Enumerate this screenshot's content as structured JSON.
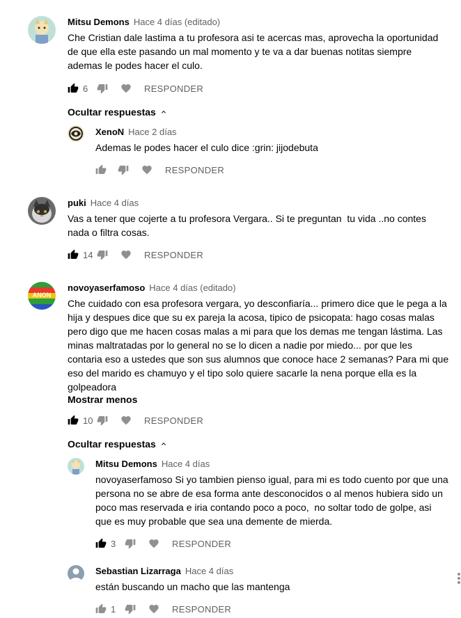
{
  "labels": {
    "reply": "RESPONDER",
    "hide_replies": "Ocultar respuestas",
    "show_less": "Mostrar menos"
  },
  "comments": [
    {
      "author": "Mitsu Demons",
      "time": "Hace 4 días (editado)",
      "text": "Che Cristian dale lastima a tu profesora asi te acercas mas, aprovecha la oportunidad\nde que ella este pasando un mal momento y te va a dar buenas notitas siempre\nademas le podes hacer el culo.",
      "likes": "6"
    },
    {
      "author": "XenoN",
      "time": "Hace 2 días",
      "text": "Ademas le podes hacer el culo dice :grin: jijodebuta",
      "likes": ""
    },
    {
      "author": "puki",
      "time": "Hace 4 días",
      "text": "Vas a tener que cojerte a tu profesora Vergara.. Si te preguntan  tu vida ..no contes\nnada o filtra cosas.",
      "likes": "14"
    },
    {
      "author": "novoyaserfamoso",
      "time": "Hace 4 días (editado)",
      "text": "Che cuidado con esa profesora vergara, yo desconfiaría... primero dice que le pega a la\nhija y despues dice que su ex pareja la acosa, tipico de psicopata: hago cosas malas\npero digo que me hacen cosas malas a mi para que los demas me tengan lástima. Las\nminas maltratadas por lo general no se lo dicen a nadie por miedo... por que les\ncontaria eso a ustedes que son sus alumnos que conoce hace 2 semanas? Para mi que\neso del marido es chamuyo y el tipo solo quiere sacarle la nena porque ella es la\ngolpeadora",
      "likes": "10",
      "avatar_text": "ANON"
    },
    {
      "author": "Mitsu Demons",
      "time": "Hace 4 días",
      "text": "novoyaserfamoso Si yo tambien pienso igual, para mi es todo cuento por que una\npersona no se abre de esa forma ante desconocidos o al menos hubiera sido un\npoco mas reservada e iria contando poco a poco,  no soltar todo de golpe, asi\nque es muy probable que sea una demente de mierda.",
      "likes": "3"
    },
    {
      "author": "Sebastian Lizarraga",
      "time": "Hace 4 días",
      "text": "están buscando un macho que las mantenga",
      "likes": "1"
    }
  ]
}
